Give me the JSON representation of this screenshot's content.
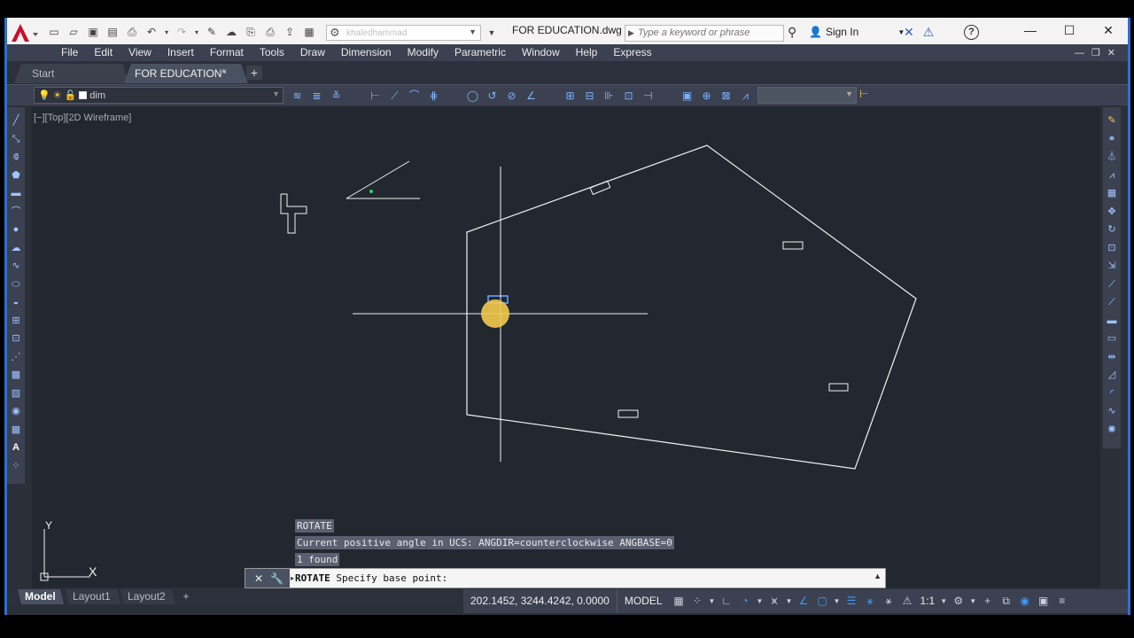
{
  "titlebar": {
    "workspace_placeholder": "khaledhammad",
    "document_title": "FOR EDUCATION.dwg",
    "search_placeholder": "Type a keyword or phrase",
    "sign_in": "Sign In",
    "help": "?"
  },
  "menu": {
    "items": [
      "File",
      "Edit",
      "View",
      "Insert",
      "Format",
      "Tools",
      "Draw",
      "Dimension",
      "Modify",
      "Parametric",
      "Window",
      "Help",
      "Express"
    ]
  },
  "tabs": {
    "start": "Start",
    "document": "FOR EDUCATION*",
    "close": "×",
    "add": "+"
  },
  "layer": {
    "current": "dim"
  },
  "viewport": {
    "label": "[−][Top][2D Wireframe]"
  },
  "ucs": {
    "y": "Y",
    "x": "X"
  },
  "command": {
    "history": [
      "ROTATE",
      "Current positive angle in UCS:  ANGDIR=counterclockwise  ANGBASE=0",
      "1 found"
    ],
    "current_command": "ROTATE",
    "prompt": "Specify base point:"
  },
  "layout_tabs": {
    "model": "Model",
    "layout1": "Layout1",
    "layout2": "Layout2",
    "add": "+"
  },
  "status": {
    "coordinates": "202.1452, 3244.4242, 0.0000",
    "space": "MODEL",
    "annotation_scale": "1:1"
  },
  "colors": {
    "canvas": "#212830",
    "ui_panel": "#3b4150",
    "cursor_highlight": "#f2c94c",
    "accent_blue": "#3d9bff",
    "logo_red": "#c8102e"
  }
}
